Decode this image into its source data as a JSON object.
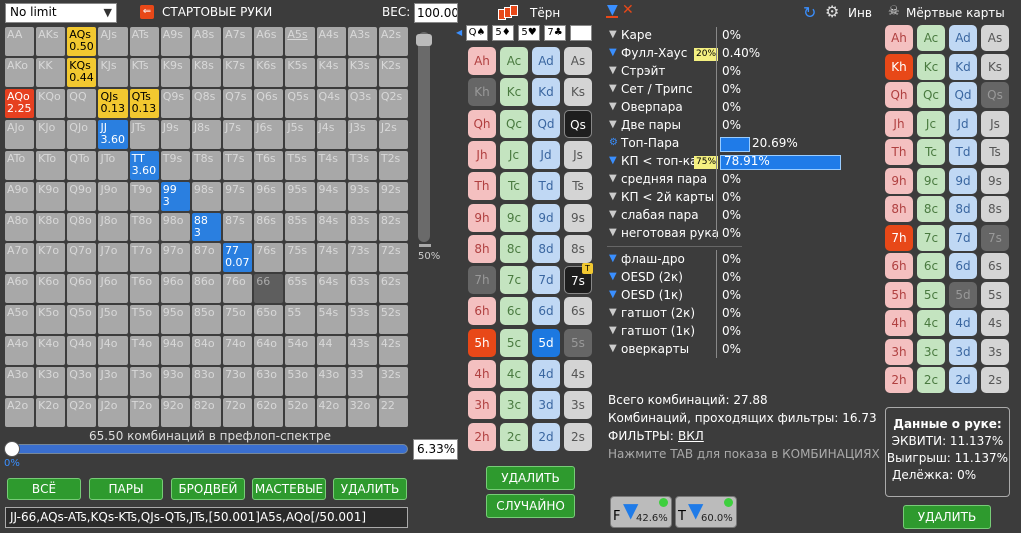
{
  "preflop": {
    "limit_select": "No limit",
    "title": "СТАРТОВЫЕ РУКИ",
    "weight_label": "ВЕС:",
    "weight_value": "100.00",
    "slider_label": "50%",
    "combos_text": "65.50 комбинаций в префлоп-спектре",
    "pct_value": "6.33%",
    "pct_small": "0%",
    "buttons": [
      "ВСЁ",
      "ПАРЫ",
      "БРОДВЕЙ",
      "МАСТЕВЫЕ",
      "УДАЛИТЬ"
    ],
    "range_text": "JJ-66,AQs-ATs,KQs-KTs,QJs-QTs,JTs,[50.001]A5s,AQo[/50.001]"
  },
  "grid": [
    [
      "AA",
      "AKs",
      "AQs",
      "AJs",
      "ATs",
      "A9s",
      "A8s",
      "A7s",
      "A6s",
      "A5s",
      "A4s",
      "A3s",
      "A2s"
    ],
    [
      "AKo",
      "KK",
      "KQs",
      "KJs",
      "KTs",
      "K9s",
      "K8s",
      "K7s",
      "K6s",
      "K5s",
      "K4s",
      "K3s",
      "K2s"
    ],
    [
      "AQo",
      "KQo",
      "QQ",
      "QJs",
      "QTs",
      "Q9s",
      "Q8s",
      "Q7s",
      "Q6s",
      "Q5s",
      "Q4s",
      "Q3s",
      "Q2s"
    ],
    [
      "AJo",
      "KJo",
      "QJo",
      "JJ",
      "JTs",
      "J9s",
      "J8s",
      "J7s",
      "J6s",
      "J5s",
      "J4s",
      "J3s",
      "J2s"
    ],
    [
      "ATo",
      "KTo",
      "QTo",
      "JTo",
      "TT",
      "T9s",
      "T8s",
      "T7s",
      "T6s",
      "T5s",
      "T4s",
      "T3s",
      "T2s"
    ],
    [
      "A9o",
      "K9o",
      "Q9o",
      "J9o",
      "T9o",
      "99",
      "98s",
      "97s",
      "96s",
      "95s",
      "94s",
      "93s",
      "92s"
    ],
    [
      "A8o",
      "K8o",
      "Q8o",
      "J8o",
      "T8o",
      "98o",
      "88",
      "87s",
      "86s",
      "85s",
      "84s",
      "83s",
      "82s"
    ],
    [
      "A7o",
      "K7o",
      "Q7o",
      "J7o",
      "T7o",
      "97o",
      "87o",
      "77",
      "76s",
      "75s",
      "74s",
      "73s",
      "72s"
    ],
    [
      "A6o",
      "K6o",
      "Q6o",
      "J6o",
      "T6o",
      "96o",
      "86o",
      "76o",
      "66",
      "65s",
      "64s",
      "63s",
      "62s"
    ],
    [
      "A5o",
      "K5o",
      "Q5o",
      "J5o",
      "T5o",
      "95o",
      "85o",
      "75o",
      "65o",
      "55",
      "54s",
      "53s",
      "52s"
    ],
    [
      "A4o",
      "K4o",
      "Q4o",
      "J4o",
      "T4o",
      "94o",
      "84o",
      "74o",
      "64o",
      "54o",
      "44",
      "43s",
      "42s"
    ],
    [
      "A3o",
      "K3o",
      "Q3o",
      "J3o",
      "T3o",
      "93o",
      "83o",
      "73o",
      "63o",
      "53o",
      "43o",
      "33",
      "32s"
    ],
    [
      "A2o",
      "K2o",
      "Q2o",
      "J2o",
      "T2o",
      "92o",
      "82o",
      "72o",
      "62o",
      "52o",
      "42o",
      "32o",
      "22"
    ]
  ],
  "grid_sub": {
    "0,2": "0.50",
    "1,2": "0.44",
    "2,0": "2.25",
    "2,3": "0.13",
    "2,4": "0.13",
    "3,3": "3.60",
    "4,4": "3.60",
    "5,5": "3",
    "6,6": "3",
    "7,7": "0.07"
  },
  "turn": {
    "title": "Тёрн",
    "board": [
      "Q♠",
      "5♦",
      "5♥",
      "7♣",
      ""
    ],
    "delete_button": "УДАЛИТЬ",
    "random_button": "СЛУЧАЙНО",
    "ranks": [
      "A",
      "K",
      "Q",
      "J",
      "T",
      "9",
      "8",
      "7",
      "6",
      "5",
      "4",
      "3",
      "2"
    ]
  },
  "stats": {
    "rows": [
      {
        "label": "Каре",
        "value": "0%"
      },
      {
        "label": "Фулл-Хаус",
        "value": "0.40%",
        "tag": "20%"
      },
      {
        "label": "Стрэйт",
        "value": "0%"
      },
      {
        "label": "Сет / Трипс",
        "value": "0%"
      },
      {
        "label": "Оверпара",
        "value": "0%"
      },
      {
        "label": "Две пары",
        "value": "0%"
      },
      {
        "label": "Топ-Пара",
        "value": "20.69%"
      },
      {
        "label": "КП < топ-ка",
        "value": "78.91%",
        "tag": "75%"
      },
      {
        "label": "средняя пара",
        "value": "0%"
      },
      {
        "label": "КП < 2й карты",
        "value": "0%"
      },
      {
        "label": "слабая пара",
        "value": "0%"
      },
      {
        "label": "неготовая рука",
        "value": "0%"
      }
    ],
    "draws": [
      {
        "label": "флаш-дро",
        "value": "0%"
      },
      {
        "label": "OESD (2к)",
        "value": "0%"
      },
      {
        "label": "OESD (1к)",
        "value": "0%"
      },
      {
        "label": "гатшот (2к)",
        "value": "0%"
      },
      {
        "label": "гатшот (1к)",
        "value": "0%"
      },
      {
        "label": "оверкарты",
        "value": "0%"
      }
    ],
    "total": "Всего комбинаций: 27.88",
    "passing": "Комбинаций, проходящих фильтры: 16.73",
    "filters_label": "ФИЛЬТРЫ:",
    "filters_value": "ВКЛ",
    "hint": "Нажмите TAB для показа в КОМБИНАЦИЯХ",
    "f_pct": "42.6%",
    "t_pct": "60.0%",
    "f_letter": "F",
    "t_letter": "T"
  },
  "dead": {
    "title": "Мёртвые карты",
    "inv": "Инв",
    "delete_button": "УДАЛИТЬ",
    "info_title": "Данные о руке:",
    "equity": "ЭКВИТИ: 11.137%",
    "win": "Выигрыш: 11.137%",
    "split": "Делёжка: 0%"
  },
  "colors": {
    "bg": "#3c3c3c",
    "green": "#2e9a2e",
    "blue": "#1f7be8",
    "red": "#e84818"
  }
}
